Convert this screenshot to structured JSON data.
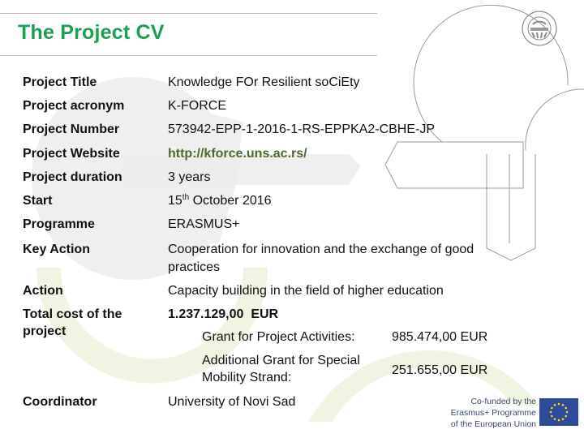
{
  "slide": {
    "title": "The Project CV"
  },
  "rows": [
    {
      "label": "Project Title",
      "value": "Knowledge FOr Resilient soCiEty"
    },
    {
      "label": "Project acronym",
      "value": "K-FORCE"
    },
    {
      "label": "Project Number",
      "value": "573942-EPP-1-2016-1-RS-EPPKA2-CBHE-JP"
    },
    {
      "label": "Project Website",
      "value": "http://kforce.uns.ac.rs/"
    },
    {
      "label": "Project duration",
      "value": "3 years"
    },
    {
      "label": "Start",
      "value_day": "15",
      "value_suffix": "th",
      "value_rest": " October 2016"
    },
    {
      "label": "Programme",
      "value": "ERASMUS+"
    },
    {
      "label": "Key Action",
      "value": "Cooperation for innovation and the exchange of good practices"
    },
    {
      "label": "Action",
      "value": "Capacity building in the field of higher education"
    },
    {
      "label": "Total cost of the project",
      "value": "1.237.129,00  EUR"
    },
    {
      "label": "Coordinator",
      "value": "University of Novi Sad"
    }
  ],
  "cost_breakdown": [
    {
      "label": "Grant for Project Activities:",
      "value": "985.474,00 EUR"
    },
    {
      "label": "Additional Grant for Special Mobility Strand:",
      "value": "251.655,00 EUR"
    }
  ],
  "footer": {
    "cofunded_line1": "Co-funded by the",
    "cofunded_line2": "Erasmus+ Programme",
    "cofunded_line3": "of the European Union"
  },
  "colors": {
    "title": "#19a050",
    "link": "#4c6a2a",
    "eu_blue": "#2e4a9a",
    "eu_star": "#ffdd00"
  }
}
